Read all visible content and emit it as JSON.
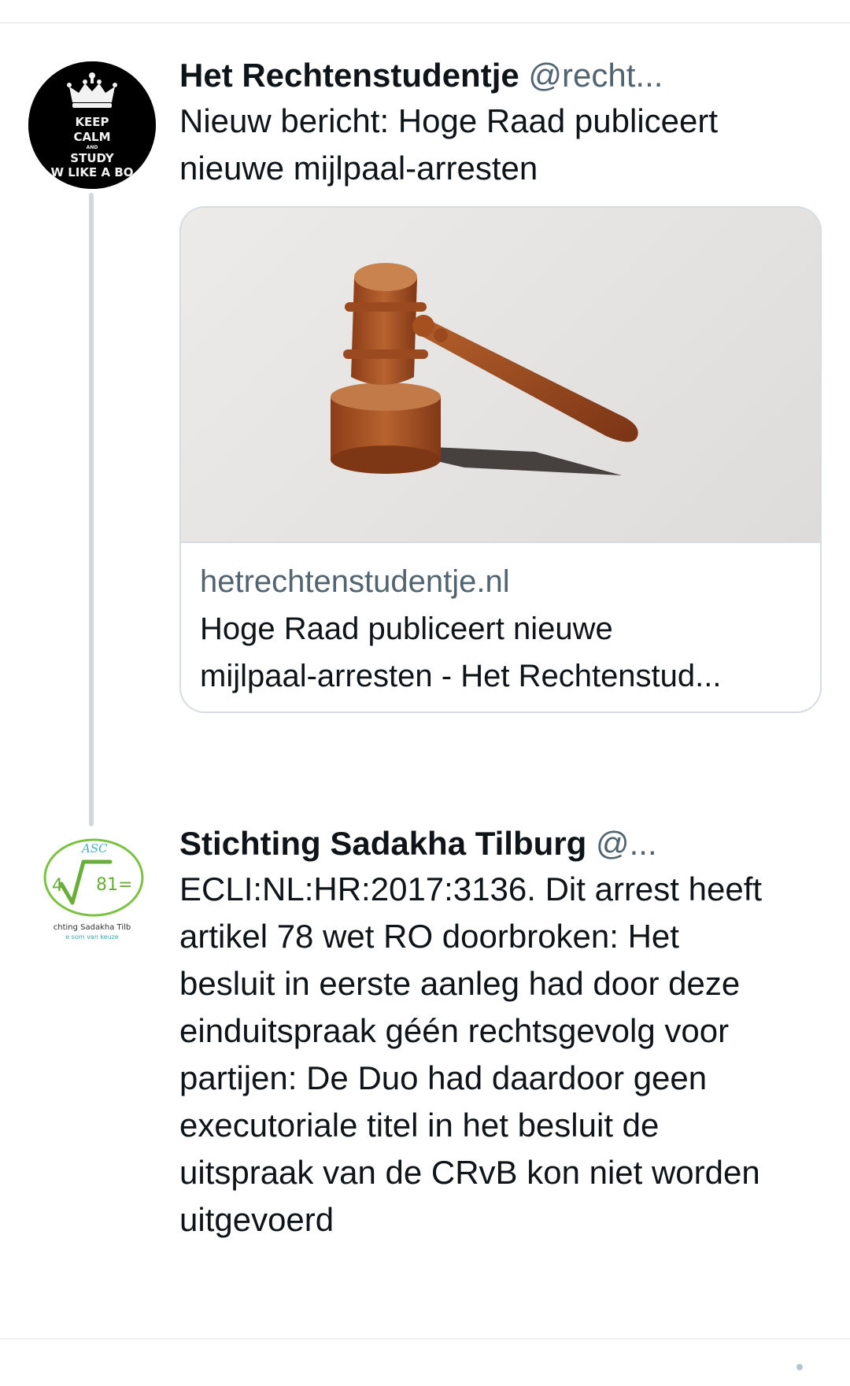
{
  "tweet1": {
    "name": "Het Rechtenstudentje",
    "handle": "@recht...",
    "text_line1": "Nieuw bericht: Hoge Raad publiceert",
    "text_line2": "nieuwe mijlpaal-arresten",
    "avatar_text": {
      "line1": "KEEP",
      "line2": "CALM",
      "line3": "AND",
      "line4": "STUDY",
      "line5": "W LIKE A BO"
    },
    "card": {
      "domain": "hetrechtenstudentje.nl",
      "title_line1": "Hoge Raad publiceert nieuwe",
      "title_line2": "mijlpaal-arresten - Het Rechtenstud..."
    }
  },
  "tweet2": {
    "name": "Stichting Sadakha Tilburg",
    "handle": "@...",
    "lines": [
      "ECLI:NL:HR:2017:3136. Dit arrest heeft",
      "artikel 78 wet RO doorbroken: Het",
      "besluit in eerste aanleg had door deze",
      "einduitspraak géén rechtsgevolg voor",
      "partijen: De Duo had daardoor geen",
      "executoriale titel in het besluit de",
      "uitspraak van de CRvB kon niet worden",
      "uitgevoerd"
    ],
    "avatar_text": {
      "top": "ASC",
      "left": "4",
      "right": "81=",
      "line1": "chting Sadakha Tilb",
      "line2": "e som van keuze"
    }
  },
  "colors": {
    "name": "#0f1419",
    "handle": "#536471",
    "thread_line": "#cfd9de",
    "card_border": "#d6dce0",
    "avatar2_green": "#7cc242",
    "avatar2_teal": "#3fa4b8"
  }
}
